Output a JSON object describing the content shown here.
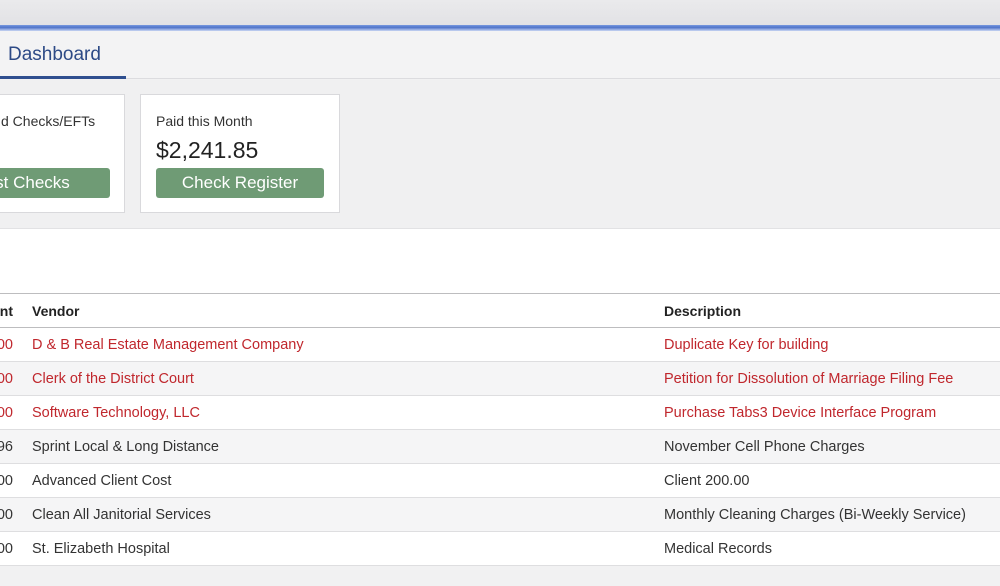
{
  "tabs": {
    "dashboard": "Dashboard"
  },
  "cards": {
    "checks": {
      "label": "d Checks/EFTs",
      "button": "st Checks"
    },
    "paid": {
      "label": "Paid this Month",
      "value": "$2,241.85",
      "button": "Check Register"
    }
  },
  "table": {
    "headers": {
      "amount": "nt",
      "vendor": "Vendor",
      "description": "Description"
    },
    "rows": [
      {
        "amount": "00",
        "vendor": "D & B Real Estate Management Company",
        "description": "Duplicate Key for building",
        "style": "red"
      },
      {
        "amount": "00",
        "vendor": "Clerk of the District Court",
        "description": "Petition for Dissolution of Marriage Filing Fee",
        "style": "red"
      },
      {
        "amount": "00",
        "vendor": "Software Technology, LLC",
        "description": "Purchase Tabs3 Device Interface Program",
        "style": "red"
      },
      {
        "amount": "96",
        "vendor": "Sprint Local & Long Distance",
        "description": "November Cell Phone Charges",
        "style": "dark"
      },
      {
        "amount": "00",
        "vendor": "Advanced Client Cost",
        "description": "Client 200.00",
        "style": "dark"
      },
      {
        "amount": "00",
        "vendor": "Clean All Janitorial Services",
        "description": "Monthly Cleaning Charges (Bi-Weekly Service)",
        "style": "dark"
      },
      {
        "amount": "00",
        "vendor": "St. Elizabeth Hospital",
        "description": "Medical Records",
        "style": "dark"
      }
    ]
  },
  "colors": {
    "accent": "#2f4f8f",
    "button": "#6f9b75",
    "link_red": "#c0272d"
  }
}
